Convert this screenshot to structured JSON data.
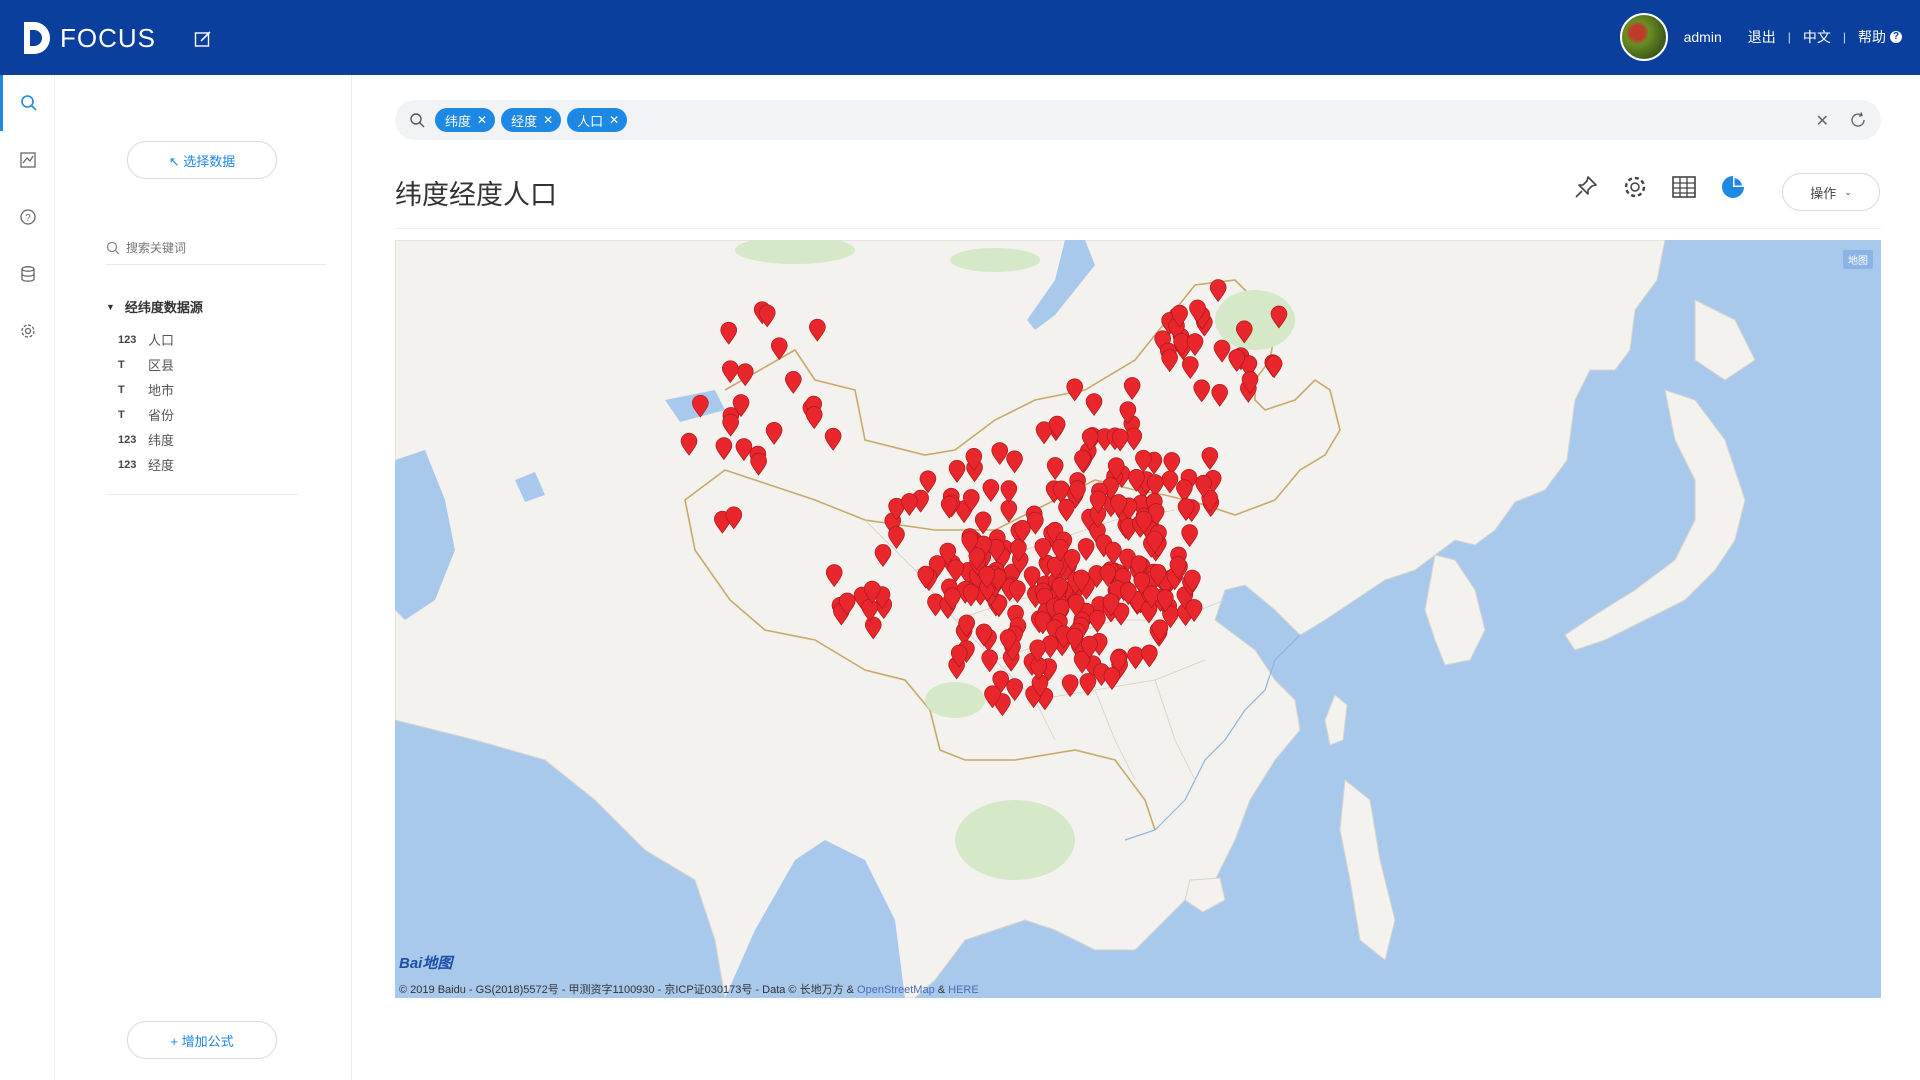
{
  "app": {
    "name": "FOCUS"
  },
  "header": {
    "username": "admin",
    "logout": "退出",
    "language": "中文",
    "help": "帮助"
  },
  "rail": {
    "items": [
      {
        "icon": "search-icon",
        "active": true
      },
      {
        "icon": "chart-board-icon",
        "active": false
      },
      {
        "icon": "question-icon",
        "active": false
      },
      {
        "icon": "database-icon",
        "active": false
      },
      {
        "icon": "gear-icon",
        "active": false
      }
    ]
  },
  "panel": {
    "select_data": "↖ 选择数据",
    "search_placeholder": "搜索关键词",
    "source_name": "经纬度数据源",
    "fields": [
      {
        "type": "123",
        "name": "人口"
      },
      {
        "type": "T",
        "name": "区县"
      },
      {
        "type": "T",
        "name": "地市"
      },
      {
        "type": "T",
        "name": "省份"
      },
      {
        "type": "123",
        "name": "纬度"
      },
      {
        "type": "123",
        "name": "经度"
      }
    ],
    "add_formula": "+ 增加公式"
  },
  "search": {
    "tags": [
      "纬度",
      "经度",
      "人口"
    ]
  },
  "main": {
    "title": "纬度经度人口",
    "ops_label": "操作"
  },
  "map": {
    "type_badge": "地图",
    "baidu_logo_a": "Bai",
    "baidu_logo_b": "地图",
    "copyright": "© 2019 Baidu - GS(2018)5572号 - 甲测资字1100930 - 京ICP证030173号 - Data © 长地万方 & ",
    "osm": "OpenStreetMap",
    "amp": " & ",
    "here": "HERE",
    "colors": {
      "water": "#a9c9ec",
      "land": "#f2f1ee",
      "pin": "#e8262c"
    }
  }
}
